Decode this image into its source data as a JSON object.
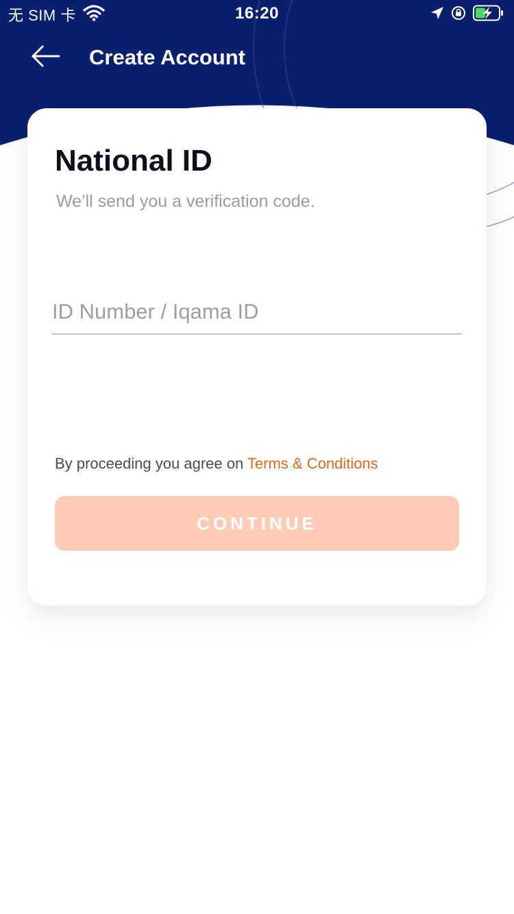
{
  "status_bar": {
    "carrier": "无 SIM 卡",
    "time": "16:20",
    "icons": [
      "wifi-icon",
      "location-arrow-icon",
      "orientation-lock-icon",
      "battery-charging-icon"
    ]
  },
  "header": {
    "back_icon": "arrow-left-icon",
    "title": "Create Account"
  },
  "card": {
    "title": "National ID",
    "subtitle": "We’ll send you a verification code.",
    "id_input": {
      "placeholder": "ID Number / Iqama ID",
      "value": ""
    },
    "terms_prefix": "By proceeding you agree on ",
    "terms_link": "Terms & Conditions",
    "continue_label": "CONTINUE"
  },
  "colors": {
    "header_bg": "#0a1f6e",
    "accent": "#e0671c",
    "button_disabled_bg": "#fecbb6"
  }
}
